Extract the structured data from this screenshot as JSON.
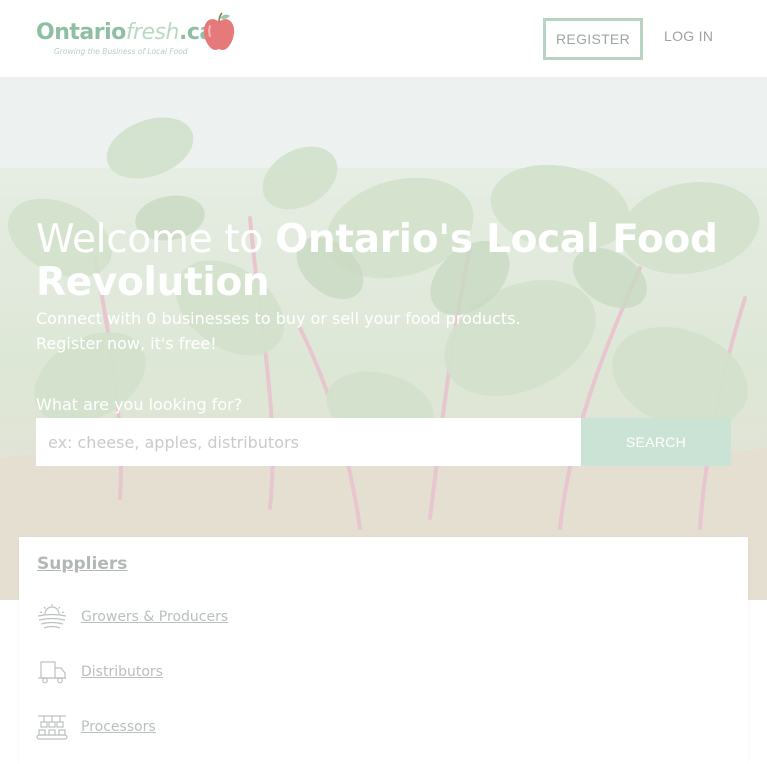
{
  "header": {
    "logo": {
      "word_main": "Ontario",
      "word_fresh": "fresh",
      "word_ca": ".ca",
      "tagline": "Growing the Business of Local Food"
    },
    "register_label": "REGISTER",
    "login_label": "LOG IN"
  },
  "hero": {
    "title_light": "Welcome to",
    "title_bold": "Ontario's Local Food Revolution",
    "subtitle_line1": "Connect with 0 businesses to buy or sell your food products.",
    "subtitle_line2": "Register now, it's free!",
    "search_label": "What are you looking for?",
    "search_placeholder": "ex: cheese, apples, distributors",
    "search_value": "",
    "search_button": "SEARCH"
  },
  "suppliers": {
    "title": "Suppliers",
    "categories": [
      {
        "label": "Growers & Producers",
        "icon": "sun-field-icon"
      },
      {
        "label": "Distributors",
        "icon": "truck-icon"
      },
      {
        "label": "Processors",
        "icon": "conveyor-icon"
      }
    ]
  },
  "colors": {
    "brand_green": "#8fbfa3",
    "search_button_bg": "#cbe3d4",
    "apple_red": "#e06466"
  }
}
